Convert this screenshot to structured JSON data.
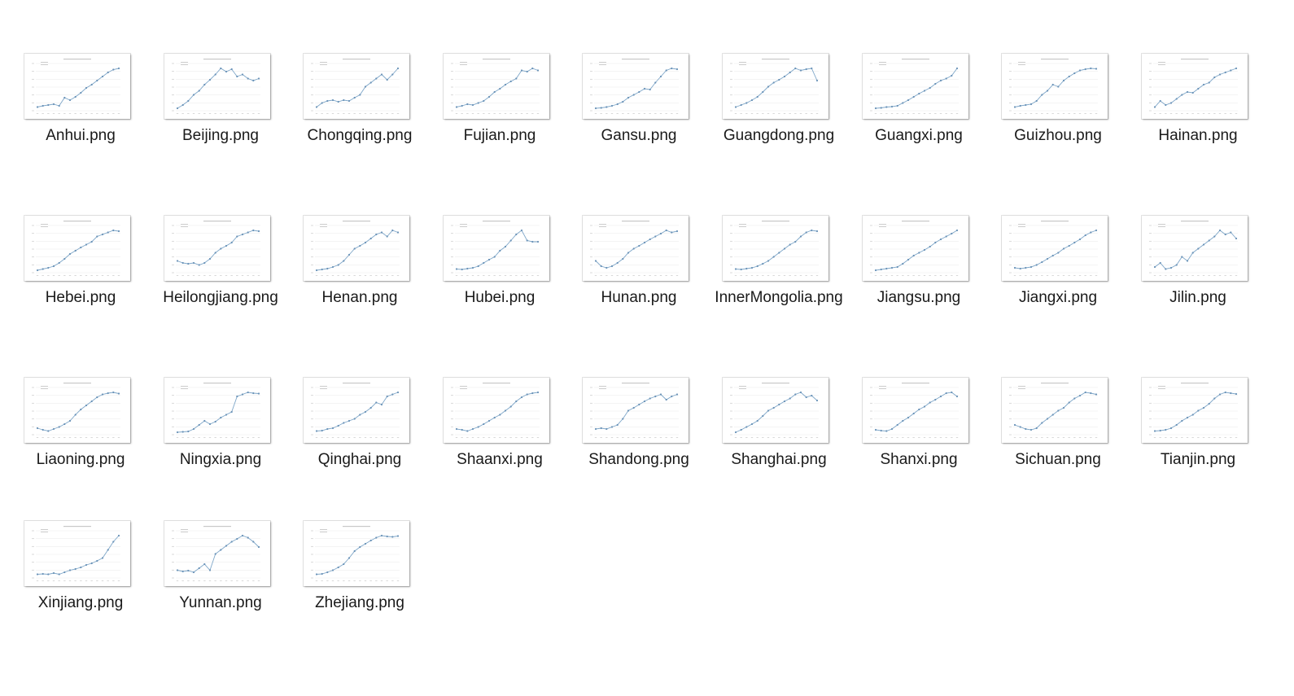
{
  "files": [
    {
      "name": "Anhui.png",
      "trend": [
        0.05,
        0.08,
        0.1,
        0.12,
        0.08,
        0.28,
        0.22,
        0.3,
        0.4,
        0.52,
        0.6,
        0.7,
        0.8,
        0.9,
        0.97,
        1.0
      ]
    },
    {
      "name": "Beijing.png",
      "trend": [
        0.02,
        0.1,
        0.2,
        0.35,
        0.45,
        0.6,
        0.72,
        0.85,
        1.0,
        0.92,
        0.98,
        0.8,
        0.85,
        0.75,
        0.7,
        0.75
      ]
    },
    {
      "name": "Chongqing.png",
      "trend": [
        0.05,
        0.15,
        0.2,
        0.22,
        0.18,
        0.22,
        0.2,
        0.28,
        0.35,
        0.55,
        0.65,
        0.75,
        0.85,
        0.72,
        0.85,
        1.0
      ]
    },
    {
      "name": "Fujian.png",
      "trend": [
        0.05,
        0.08,
        0.12,
        0.1,
        0.15,
        0.2,
        0.3,
        0.42,
        0.5,
        0.6,
        0.68,
        0.75,
        0.95,
        0.92,
        1.0,
        0.95
      ]
    },
    {
      "name": "Gansu.png",
      "trend": [
        0.02,
        0.03,
        0.05,
        0.08,
        0.12,
        0.18,
        0.28,
        0.35,
        0.42,
        0.5,
        0.48,
        0.65,
        0.8,
        0.95,
        1.0,
        0.98
      ]
    },
    {
      "name": "Guangdong.png",
      "trend": [
        0.05,
        0.1,
        0.15,
        0.22,
        0.3,
        0.42,
        0.55,
        0.65,
        0.72,
        0.8,
        0.9,
        1.0,
        0.95,
        0.98,
        1.0,
        0.7
      ]
    },
    {
      "name": "Guangxi.png",
      "trend": [
        0.02,
        0.03,
        0.05,
        0.06,
        0.08,
        0.15,
        0.22,
        0.3,
        0.38,
        0.45,
        0.52,
        0.62,
        0.7,
        0.75,
        0.82,
        1.0
      ]
    },
    {
      "name": "Guizhou.png",
      "trend": [
        0.05,
        0.08,
        0.1,
        0.12,
        0.2,
        0.35,
        0.45,
        0.6,
        0.55,
        0.7,
        0.8,
        0.88,
        0.95,
        0.98,
        1.0,
        0.99
      ]
    },
    {
      "name": "Hainan.png",
      "trend": [
        0.05,
        0.2,
        0.1,
        0.15,
        0.25,
        0.35,
        0.42,
        0.4,
        0.5,
        0.6,
        0.65,
        0.78,
        0.85,
        0.9,
        0.95,
        1.0
      ]
    },
    {
      "name": "Hebei.png",
      "trend": [
        0.02,
        0.05,
        0.08,
        0.12,
        0.2,
        0.3,
        0.42,
        0.5,
        0.58,
        0.65,
        0.72,
        0.85,
        0.9,
        0.95,
        1.0,
        0.98
      ]
    },
    {
      "name": "Heilongjiang.png",
      "trend": [
        0.25,
        0.2,
        0.18,
        0.2,
        0.15,
        0.2,
        0.3,
        0.45,
        0.55,
        0.62,
        0.7,
        0.85,
        0.9,
        0.95,
        1.0,
        0.98
      ]
    },
    {
      "name": "Henan.png",
      "trend": [
        0.02,
        0.04,
        0.06,
        0.1,
        0.15,
        0.25,
        0.4,
        0.55,
        0.62,
        0.7,
        0.8,
        0.9,
        0.95,
        0.85,
        1.0,
        0.95
      ]
    },
    {
      "name": "Hubei.png",
      "trend": [
        0.05,
        0.04,
        0.06,
        0.08,
        0.12,
        0.2,
        0.28,
        0.35,
        0.5,
        0.6,
        0.75,
        0.9,
        1.0,
        0.75,
        0.72,
        0.72
      ]
    },
    {
      "name": "Hunan.png",
      "trend": [
        0.25,
        0.12,
        0.08,
        0.12,
        0.2,
        0.3,
        0.45,
        0.55,
        0.62,
        0.7,
        0.78,
        0.85,
        0.92,
        1.0,
        0.95,
        0.98
      ]
    },
    {
      "name": "InnerMongolia.png",
      "trend": [
        0.05,
        0.04,
        0.06,
        0.08,
        0.12,
        0.18,
        0.25,
        0.35,
        0.45,
        0.55,
        0.65,
        0.72,
        0.85,
        0.95,
        1.0,
        0.98
      ]
    },
    {
      "name": "Jiangsu.png",
      "trend": [
        0.02,
        0.04,
        0.06,
        0.08,
        0.1,
        0.18,
        0.28,
        0.38,
        0.45,
        0.52,
        0.6,
        0.7,
        0.78,
        0.85,
        0.92,
        1.0
      ]
    },
    {
      "name": "Jiangxi.png",
      "trend": [
        0.08,
        0.06,
        0.08,
        0.1,
        0.15,
        0.22,
        0.3,
        0.38,
        0.45,
        0.55,
        0.62,
        0.7,
        0.78,
        0.88,
        0.95,
        1.0
      ]
    },
    {
      "name": "Jilin.png",
      "trend": [
        0.1,
        0.2,
        0.05,
        0.08,
        0.15,
        0.35,
        0.25,
        0.45,
        0.55,
        0.65,
        0.75,
        0.85,
        1.0,
        0.9,
        0.95,
        0.8
      ]
    },
    {
      "name": "Liaoning.png",
      "trend": [
        0.12,
        0.08,
        0.05,
        0.1,
        0.15,
        0.22,
        0.3,
        0.45,
        0.58,
        0.68,
        0.78,
        0.88,
        0.95,
        0.98,
        1.0,
        0.97
      ]
    },
    {
      "name": "Ningxia.png",
      "trend": [
        0.02,
        0.03,
        0.04,
        0.1,
        0.2,
        0.3,
        0.22,
        0.28,
        0.38,
        0.45,
        0.52,
        0.9,
        0.95,
        1.0,
        0.98,
        0.97
      ]
    },
    {
      "name": "Qinghai.png",
      "trend": [
        0.05,
        0.06,
        0.1,
        0.12,
        0.18,
        0.25,
        0.3,
        0.35,
        0.45,
        0.52,
        0.62,
        0.75,
        0.7,
        0.9,
        0.95,
        1.0
      ]
    },
    {
      "name": "Shaanxi.png",
      "trend": [
        0.1,
        0.08,
        0.05,
        0.1,
        0.15,
        0.22,
        0.3,
        0.38,
        0.45,
        0.55,
        0.65,
        0.78,
        0.88,
        0.95,
        0.98,
        1.0
      ]
    },
    {
      "name": "Shandong.png",
      "trend": [
        0.1,
        0.12,
        0.1,
        0.15,
        0.2,
        0.35,
        0.55,
        0.62,
        0.7,
        0.78,
        0.85,
        0.9,
        0.95,
        0.82,
        0.9,
        0.95
      ]
    },
    {
      "name": "Shanghai.png",
      "trend": [
        0.02,
        0.08,
        0.15,
        0.22,
        0.3,
        0.42,
        0.55,
        0.62,
        0.7,
        0.78,
        0.85,
        0.95,
        1.0,
        0.88,
        0.92,
        0.8
      ]
    },
    {
      "name": "Shanxi.png",
      "trend": [
        0.08,
        0.06,
        0.05,
        0.1,
        0.2,
        0.3,
        0.38,
        0.48,
        0.58,
        0.65,
        0.75,
        0.82,
        0.9,
        0.98,
        1.0,
        0.9
      ]
    },
    {
      "name": "Sichuan.png",
      "trend": [
        0.2,
        0.15,
        0.1,
        0.08,
        0.12,
        0.25,
        0.35,
        0.45,
        0.55,
        0.62,
        0.75,
        0.85,
        0.92,
        1.0,
        0.98,
        0.95
      ]
    },
    {
      "name": "Tianjin.png",
      "trend": [
        0.05,
        0.06,
        0.08,
        0.12,
        0.2,
        0.3,
        0.38,
        0.45,
        0.55,
        0.62,
        0.72,
        0.85,
        0.95,
        1.0,
        0.98,
        0.96
      ]
    },
    {
      "name": "Xinjiang.png",
      "trend": [
        0.05,
        0.06,
        0.05,
        0.08,
        0.05,
        0.1,
        0.15,
        0.18,
        0.22,
        0.28,
        0.32,
        0.38,
        0.45,
        0.65,
        0.85,
        1.0
      ]
    },
    {
      "name": "Yunnan.png",
      "trend": [
        0.15,
        0.12,
        0.14,
        0.1,
        0.2,
        0.3,
        0.15,
        0.55,
        0.65,
        0.75,
        0.85,
        0.92,
        1.0,
        0.95,
        0.85,
        0.72
      ]
    },
    {
      "name": "Zhejiang.png",
      "trend": [
        0.05,
        0.06,
        0.1,
        0.15,
        0.22,
        0.3,
        0.45,
        0.62,
        0.72,
        0.8,
        0.88,
        0.95,
        1.0,
        0.98,
        0.97,
        0.99
      ]
    }
  ],
  "colors": {
    "line": "#7fa7c9",
    "marker": "#6b93b8",
    "grid": "#e3e3e3",
    "text": "#1a1a1a"
  }
}
